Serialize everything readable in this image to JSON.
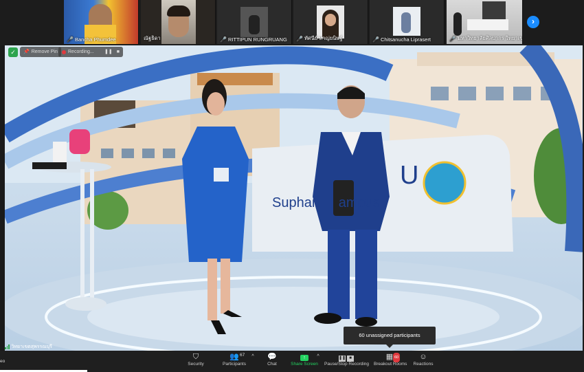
{
  "gallery": {
    "participants": [
      {
        "name": "Bancha Phumdee",
        "muted": true
      },
      {
        "name": "ณัฐธิดา",
        "muted": false
      },
      {
        "name": "RITTIPUN RUNGRUANG",
        "muted": true
      },
      {
        "name": "ทัศนีย์ หาญ่ยนิษฐ์",
        "muted": true
      },
      {
        "name": "Chitsanucha Liprasert",
        "muted": true
      },
      {
        "name": "มหาวิทยาลัยศิลปากร วิทยาเขต...",
        "muted": true
      }
    ],
    "next_icon": "chevron-right-icon"
  },
  "main_video": {
    "remove_pin": "Remove Pin",
    "recording": "Recording...",
    "backdrop_text_left": "U",
    "backdrop_text_bottom": "Suphan     ampus",
    "connection_label": "วิทยาเขตสุพรรณบุรี"
  },
  "tooltip": {
    "text": "60 unassigned participants"
  },
  "toolbar": {
    "left_label": "eo",
    "security": "Security",
    "participants": "Participants",
    "participants_count": "67",
    "chat": "Chat",
    "share_screen": "Share Screen",
    "pause_stop_recording": "Pause/Stop Recording",
    "breakout_rooms": "Breakout Rooms",
    "breakout_badge": "60",
    "reactions": "Reactions"
  },
  "colors": {
    "accent_green": "#23d160",
    "zoom_blue": "#1a8cff",
    "muted_red": "#e0393e"
  }
}
